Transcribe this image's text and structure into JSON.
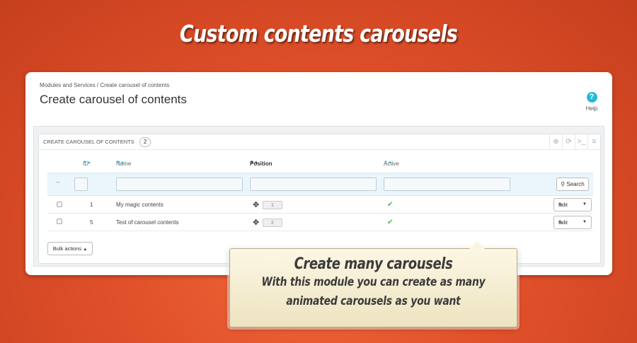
{
  "hero": {
    "title": "Custom contents carousels"
  },
  "header": {
    "breadcrumb": "Modules and Services  /  Create carousel of contents",
    "title": "Create carousel of contents",
    "help_label": "Help",
    "help_icon": "question-circle-icon"
  },
  "listing": {
    "panel_title": "Create carousel of contents",
    "count": "2",
    "tools": [
      "add-icon",
      "refresh-icon",
      "sql-query-icon",
      "export-database-icon"
    ],
    "columns": {
      "id": "ID",
      "name": "Name",
      "position": "Position",
      "active": "Active"
    },
    "filter": {
      "dash": "--",
      "search_label": "Search"
    },
    "rows": [
      {
        "id": "1",
        "name": "My magic contents",
        "position": "1",
        "active": true,
        "edit_label": "Edit"
      },
      {
        "id": "5",
        "name": "Test of carousel contents",
        "position": "2",
        "active": true,
        "edit_label": "Edit"
      }
    ],
    "bulk_label": "Bulk actions"
  },
  "callout": {
    "title": "Create many carousels",
    "line1": "With this module you can create as many",
    "line2": "animated carousels as you want"
  },
  "colors": {
    "accent": "#25b9d7",
    "active_check": "#72c279",
    "background": "#e0502a"
  }
}
